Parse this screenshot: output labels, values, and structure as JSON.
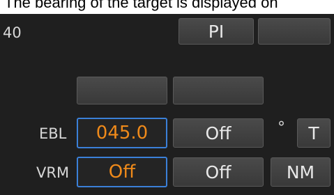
{
  "caption": "The bearing of the target is displayed on",
  "range_value": "40",
  "buttons": {
    "pi": "PI",
    "top_blank": "",
    "mid_left_blank": "",
    "mid_right_blank": ""
  },
  "ebl": {
    "label": "EBL",
    "value": "045.0",
    "toggle": "Off",
    "unit_symbol": "°",
    "reference": "T"
  },
  "vrm": {
    "label": "VRM",
    "value": "Off",
    "toggle": "Off",
    "unit": "NM"
  },
  "colors": {
    "panel": "#1f1f1f",
    "value_text": "#ef8a1a",
    "field_border": "#3b80d8"
  }
}
